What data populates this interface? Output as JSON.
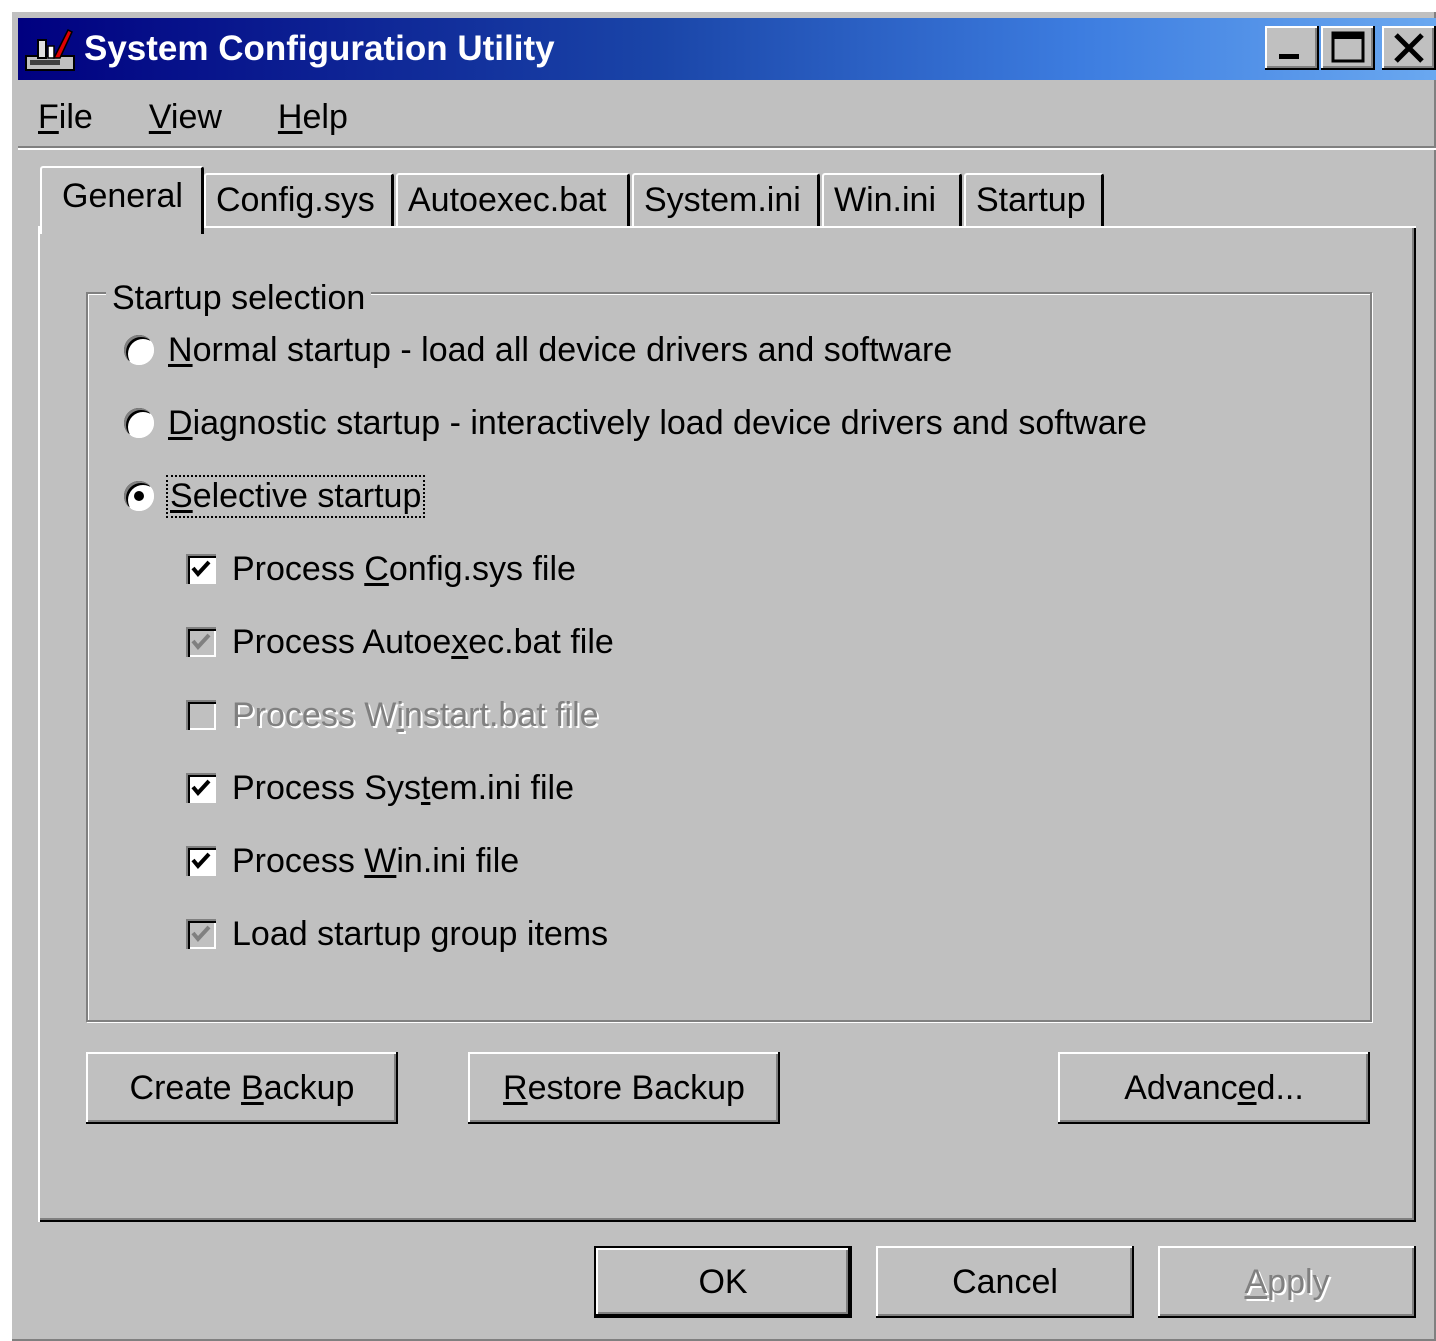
{
  "window": {
    "title": "System Configuration Utility"
  },
  "menu": [
    "File",
    "View",
    "Help"
  ],
  "tabs": [
    "General",
    "Config.sys",
    "Autoexec.bat",
    "System.ini",
    "Win.ini",
    "Startup"
  ],
  "active_tab": "General",
  "startup_selection": {
    "label": "Startup selection",
    "options": [
      {
        "label": "Normal startup - load all device drivers and software",
        "selected": false
      },
      {
        "label": "Diagnostic startup - interactively load device drivers and software",
        "selected": false
      },
      {
        "label": "Selective startup",
        "selected": true
      }
    ],
    "checkboxes": [
      {
        "label": "Process Config.sys file",
        "state": "checked"
      },
      {
        "label": "Process Autoexec.bat file",
        "state": "checked-grayed"
      },
      {
        "label": "Process Winstart.bat file",
        "state": "unchecked-disabled"
      },
      {
        "label": "Process System.ini file",
        "state": "checked"
      },
      {
        "label": "Process Win.ini file",
        "state": "checked"
      },
      {
        "label": "Load startup group items",
        "state": "checked-grayed"
      }
    ]
  },
  "panel_buttons": {
    "create_backup": "Create Backup",
    "restore_backup": "Restore Backup",
    "advanced": "Advanced..."
  },
  "dialog_buttons": {
    "ok": "OK",
    "cancel": "Cancel",
    "apply": "Apply"
  }
}
